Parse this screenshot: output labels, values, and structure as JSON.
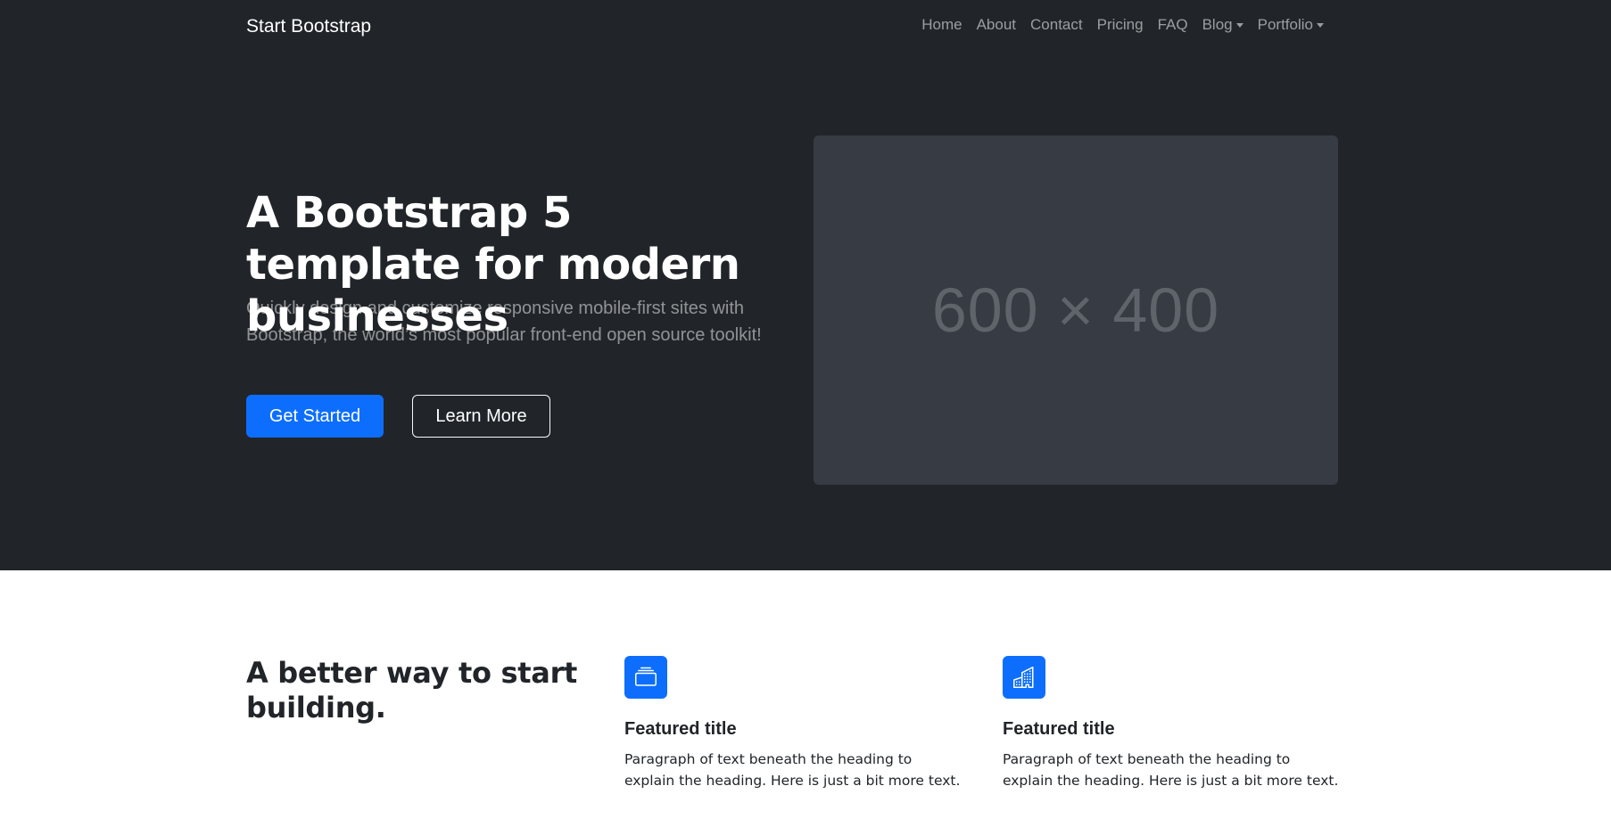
{
  "navbar": {
    "brand": "Start Bootstrap",
    "items": [
      {
        "label": "Home"
      },
      {
        "label": "About"
      },
      {
        "label": "Contact"
      },
      {
        "label": "Pricing"
      },
      {
        "label": "FAQ"
      },
      {
        "label": "Blog",
        "dropdown": true
      },
      {
        "label": "Portfolio",
        "dropdown": true
      }
    ]
  },
  "hero": {
    "title": "A Bootstrap 5 template for modern businesses",
    "lead": "Quickly design and customize responsive mobile-first sites with Bootstrap, the world’s most popular front-end open source toolkit!",
    "primary_button": "Get Started",
    "secondary_button": "Learn More",
    "image_placeholder": "600 × 400"
  },
  "features": {
    "heading": "A better way to start building.",
    "items": [
      {
        "icon": "collection-icon",
        "title": "Featured title",
        "text": "Paragraph of text beneath the heading to explain the heading. Here is just a bit more text."
      },
      {
        "icon": "building-icon",
        "title": "Featured title",
        "text": "Paragraph of text beneath the heading to explain the heading. Here is just a bit more text."
      }
    ]
  },
  "colors": {
    "dark_bg": "#212529",
    "primary": "#0d6efd",
    "placeholder_bg": "#373b43",
    "text_dark": "#212529"
  }
}
